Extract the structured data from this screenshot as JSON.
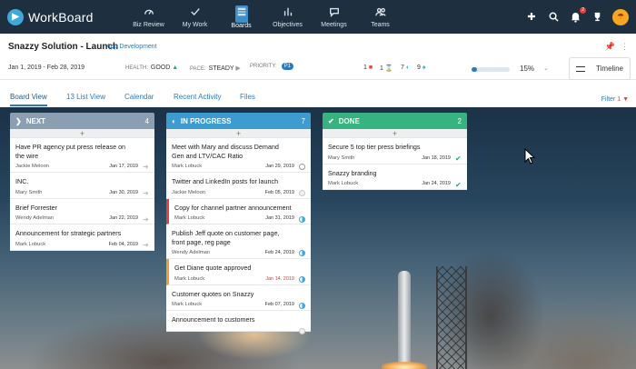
{
  "brand": {
    "name": "WorkBoard"
  },
  "nav": [
    {
      "label": "Biz Review",
      "icon": "gauge-icon"
    },
    {
      "label": "My Work",
      "icon": "check-icon"
    },
    {
      "label": "Boards",
      "icon": "boards-icon",
      "active": true
    },
    {
      "label": "Objectives",
      "icon": "bar-chart-icon"
    },
    {
      "label": "Meetings",
      "icon": "chat-icon"
    },
    {
      "label": "Teams",
      "icon": "people-icon"
    }
  ],
  "nav_badge": "2",
  "header": {
    "title": "Snazzy Solution - Launch",
    "subtitle": "App Development"
  },
  "meta": {
    "date_range": "Jan 1, 2019  -  Feb 28, 2019",
    "health_label": "HEALTH:",
    "health_value": "GOOD",
    "pace_label": "PACE:",
    "pace_value": "STEADY",
    "priority_label": "PRIORITY:",
    "priority_value": "P1",
    "count_a": "1",
    "count_b": "1",
    "count_c": "7",
    "count_d": "9",
    "progress_percent": 15,
    "progress_text": "15%",
    "timeline_label": "Timeline"
  },
  "tabs": [
    "Board View",
    "13 List View",
    "Calendar",
    "Recent Activity",
    "Files"
  ],
  "filter": {
    "label": "Filter",
    "count": "1"
  },
  "columns": [
    {
      "title": "NEXT",
      "count": "4",
      "color": "#8aa0b2",
      "cards": [
        {
          "title": "Have PR agency put press release on the wire",
          "owner": "Jackie Meloon",
          "date": "Jan 17, 2019",
          "status": "arrow"
        },
        {
          "title": "INC.",
          "owner": "Mary Smith",
          "date": "Jan 30, 2019",
          "status": "arrow"
        },
        {
          "title": "Brief Forrester",
          "owner": "Wendy Adelman",
          "date": "Jan 22, 2019",
          "status": "arrow"
        },
        {
          "title": "Announcement for strategic partners",
          "owner": "Mark Lobuck",
          "date": "Feb 04, 2019",
          "status": "arrow"
        }
      ]
    },
    {
      "title": "IN PROGRESS",
      "count": "7",
      "color": "#3d9ccf",
      "cards": [
        {
          "title": "Meet with Mary and discuss Demand Gen and LTV/CAC Ratio",
          "owner": "Mark Lobuck",
          "date": "Jan 29, 2019",
          "status": "info"
        },
        {
          "title": "Twitter and LinkedIn posts for launch",
          "owner": "Jackie Meloon",
          "date": "Feb 05, 2019",
          "status": "gray"
        },
        {
          "title": "Copy for channel partner announcement",
          "owner": "Mark Lobuck",
          "date": "Jan 31, 2019",
          "status": "half",
          "bar": "red"
        },
        {
          "title": "Publish Jeff quote on customer page, front page, reg page",
          "owner": "Wendy Adelman",
          "date": "Feb 24, 2019",
          "status": "half"
        },
        {
          "title": "Get Diane quote approved",
          "owner": "Mark Lobuck",
          "date": "Jan 14, 2019",
          "status": "half",
          "bar": "orange",
          "date_red": true
        },
        {
          "title": "Customer quotes on Snazzy",
          "owner": "Mark Lobuck",
          "date": "Feb 07, 2019",
          "status": "half"
        },
        {
          "title": "Announcement to customers",
          "owner": "",
          "date": "",
          "status": "gray"
        }
      ]
    },
    {
      "title": "DONE",
      "count": "2",
      "color": "#36b37e",
      "cards": [
        {
          "title": "Secure 5 top tier press briefings",
          "owner": "Mary Smith",
          "date": "Jan 18, 2019",
          "status": "check"
        },
        {
          "title": "Snazzy branding",
          "owner": "Mark Lobuck",
          "date": "Jan 24, 2019",
          "status": "check"
        }
      ]
    }
  ]
}
